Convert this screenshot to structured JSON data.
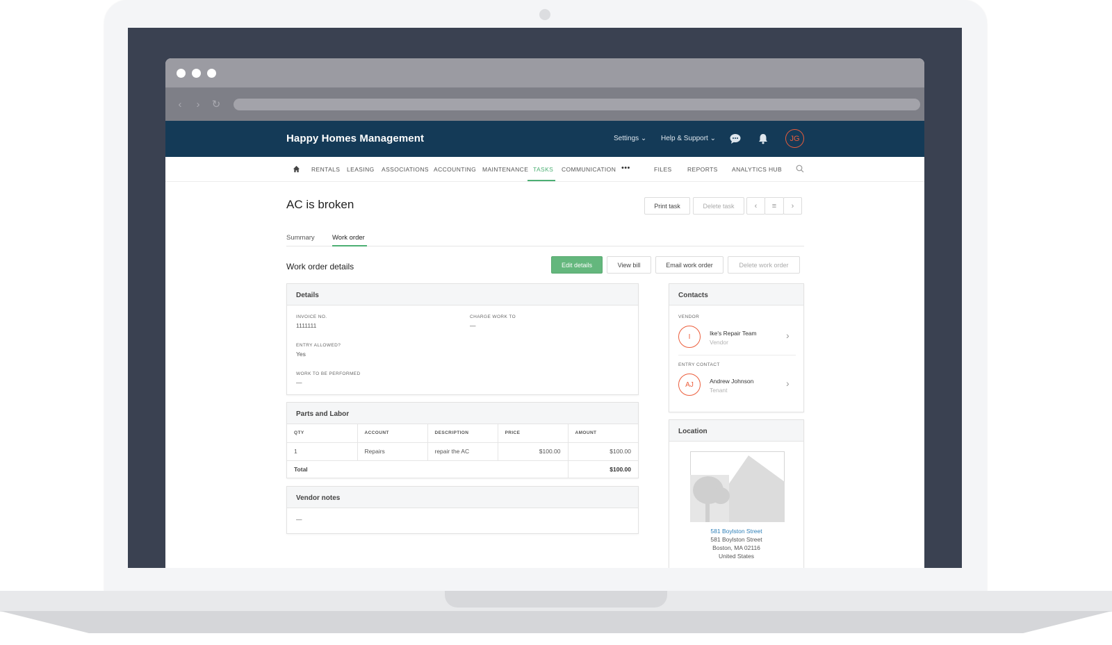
{
  "app": {
    "brand": "Happy Homes Management",
    "header_links": {
      "settings": "Settings",
      "help": "Help & Support"
    },
    "user_initials": "JG"
  },
  "nav": {
    "items": [
      "RENTALS",
      "LEASING",
      "ASSOCIATIONS",
      "ACCOUNTING",
      "MAINTENANCE",
      "TASKS",
      "COMMUNICATION",
      "•••",
      "FILES",
      "REPORTS",
      "ANALYTICS HUB"
    ],
    "active": "TASKS"
  },
  "task": {
    "title": "AC is broken",
    "actions": {
      "print": "Print task",
      "delete": "Delete task"
    },
    "tabs": [
      "Summary",
      "Work order"
    ],
    "active_tab": "Work order"
  },
  "work_order": {
    "section_title": "Work order details",
    "buttons": {
      "edit": "Edit details",
      "view_bill": "View bill",
      "email": "Email work order",
      "delete": "Delete work order"
    },
    "details": {
      "header": "Details",
      "invoice_label": "INVOICE NO.",
      "invoice_value": "1111111",
      "charge_label": "CHARGE WORK TO",
      "charge_value": "—",
      "entry_label": "ENTRY ALLOWED?",
      "entry_value": "Yes",
      "work_label": "WORK TO BE PERFORMED",
      "work_value": "—"
    },
    "parts": {
      "header": "Parts and Labor",
      "columns": [
        "QTY",
        "ACCOUNT",
        "DESCRIPTION",
        "PRICE",
        "AMOUNT"
      ],
      "rows": [
        [
          "1",
          "Repairs",
          "repair the AC",
          "$100.00",
          "$100.00"
        ]
      ],
      "total_label": "Total",
      "total_value": "$100.00"
    },
    "vendor_notes": {
      "header": "Vendor notes",
      "value": "—"
    }
  },
  "contacts": {
    "header": "Contacts",
    "vendor": {
      "label": "VENDOR",
      "initials": "I",
      "name": "Ike's Repair Team",
      "role": "Vendor"
    },
    "entry": {
      "label": "ENTRY CONTACT",
      "initials": "AJ",
      "name": "Andrew Johnson",
      "role": "Tenant"
    }
  },
  "location": {
    "header": "Location",
    "link": "581 Boylston Street",
    "street": "581 Boylston Street",
    "city": "Boston, MA 02116",
    "country": "United States"
  },
  "colors": {
    "header_bg": "#143a57",
    "accent_green": "#4caf73",
    "avatar_orange": "#ec5d3b",
    "link_blue": "#2d7fb8"
  }
}
